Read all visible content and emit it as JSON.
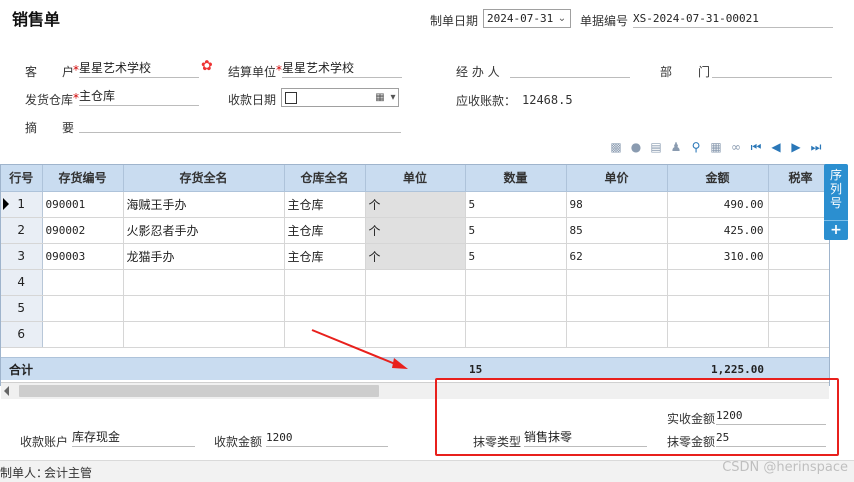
{
  "form": {
    "title": "销售单",
    "date_label": "制单日期",
    "date_value": "2024-07-31",
    "docno_label": "单据编号",
    "docno_value": "XS-2024-07-31-00021"
  },
  "header": {
    "customer_label_a": "客",
    "customer_label_b": "户",
    "customer_value": "星星艺术学校",
    "settle_label": "结算单位",
    "settle_value": "星星艺术学校",
    "handler_label": "经 办 人",
    "handler_value": "",
    "dept_label_a": "部",
    "dept_label_b": "门",
    "dept_value": "",
    "warehouse_label": "发货仓库",
    "warehouse_value": "主仓库",
    "receive_date_label": "收款日期",
    "receivable_label": "应收账款：",
    "receivable_value": "12468.5",
    "summary_label_a": "摘",
    "summary_label_b": "要",
    "summary_value": "",
    "required_mark": "*"
  },
  "toolbar": {
    "icons": [
      "grid-icon",
      "comment-icon",
      "chart-icon",
      "people-icon",
      "search-icon",
      "calculator-icon",
      "attach-icon",
      "first-icon",
      "prev-icon",
      "next-icon",
      "last-icon"
    ]
  },
  "grid": {
    "columns": [
      "行号",
      "存货编号",
      "存货全名",
      "仓库全名",
      "单位",
      "数量",
      "单价",
      "金额",
      "税率"
    ],
    "rows": [
      {
        "no": "1",
        "code": "090001",
        "name": "海贼王手办",
        "warehouse": "主仓库",
        "unit": "个",
        "qty": "5",
        "price": "98",
        "amount": "490.00",
        "tax": ""
      },
      {
        "no": "2",
        "code": "090002",
        "name": "火影忍者手办",
        "warehouse": "主仓库",
        "unit": "个",
        "qty": "5",
        "price": "85",
        "amount": "425.00",
        "tax": ""
      },
      {
        "no": "3",
        "code": "090003",
        "name": "龙猫手办",
        "warehouse": "主仓库",
        "unit": "个",
        "qty": "5",
        "price": "62",
        "amount": "310.00",
        "tax": ""
      }
    ],
    "empty_rows": [
      "4",
      "5",
      "6"
    ],
    "total_label": "合计",
    "total_qty": "15",
    "total_amount": "1,225.00"
  },
  "sidetab": {
    "label": "序列号",
    "plus": "+"
  },
  "footer": {
    "account_label": "收款账户",
    "account_value": "库存现金",
    "amount_label": "收款金额",
    "amount_value": "1200",
    "wipe_type_label": "抹零类型",
    "wipe_type_value": "销售抹零",
    "actual_label": "实收金额",
    "actual_value": "1200",
    "wipe_amount_label": "抹零金额",
    "wipe_amount_value": "25",
    "creator_label": "制单人：",
    "creator_value": "会计主管"
  },
  "watermark": "CSDN @herinspace",
  "colors": {
    "highlight": "#e8201c",
    "header_bg": "#c9dcf0",
    "sidetab": "#2b8fd0"
  }
}
